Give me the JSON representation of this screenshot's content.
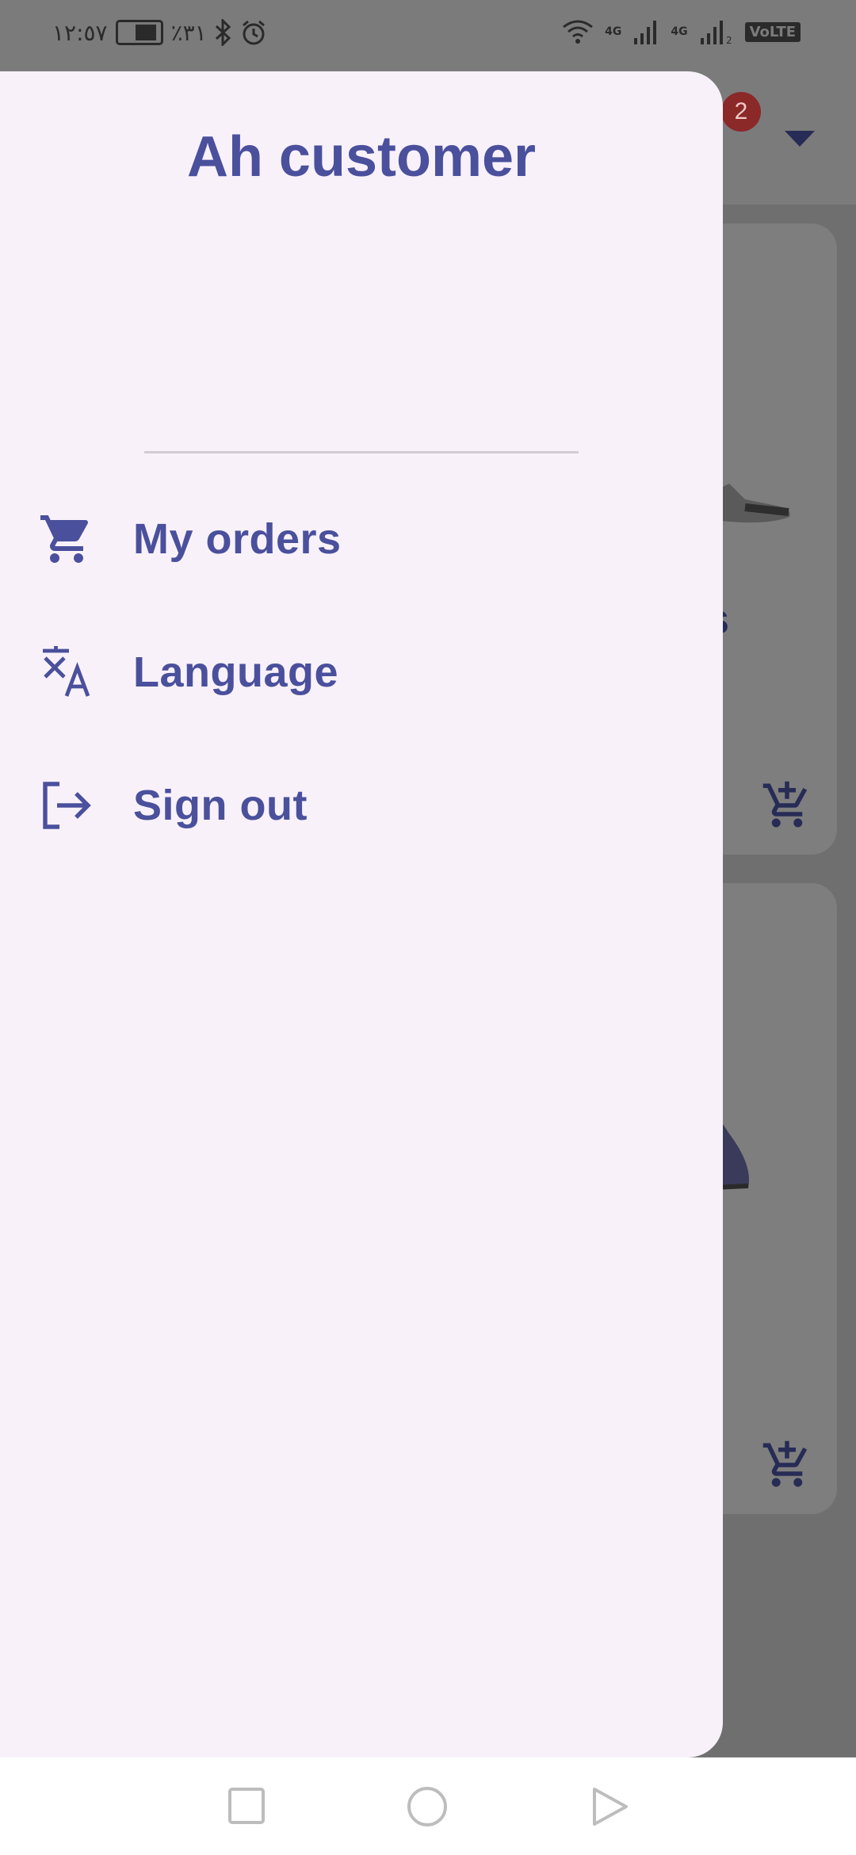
{
  "status_bar": {
    "time": "١٢:٥٧",
    "battery_text": "٪٣١",
    "volte": "VoLTE",
    "network_1": "4G",
    "network_2": "4G"
  },
  "background_app": {
    "cart_badge": "2",
    "partial_text": "s"
  },
  "drawer": {
    "title": "Ah customer",
    "items": [
      {
        "label": "My orders",
        "icon": "shopping-cart-icon"
      },
      {
        "label": "Language",
        "icon": "translate-icon"
      },
      {
        "label": "Sign out",
        "icon": "logout-icon"
      }
    ]
  },
  "colors": {
    "accent": "#4a509c",
    "drawer_bg": "#f8f1fa",
    "scrim": "#7a7a7a"
  }
}
